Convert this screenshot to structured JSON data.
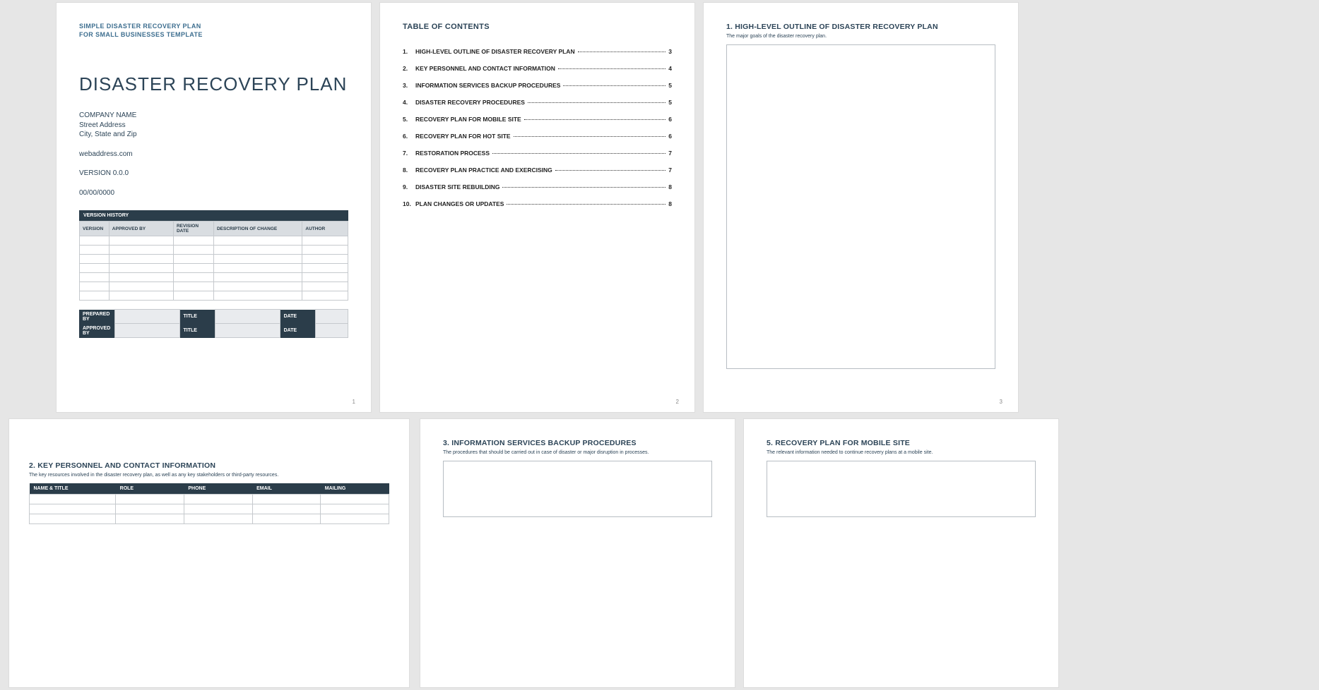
{
  "cover": {
    "small_header_1": "SIMPLE DISASTER RECOVERY PLAN",
    "small_header_2": "FOR SMALL BUSINESSES TEMPLATE",
    "title": "DISASTER RECOVERY PLAN",
    "company": "COMPANY NAME",
    "street": "Street Address",
    "city": "City, State and Zip",
    "web": "webaddress.com",
    "version": "VERSION 0.0.0",
    "date": "00/00/0000",
    "version_history_label": "VERSION HISTORY",
    "vh_cols": {
      "version": "VERSION",
      "approved": "APPROVED BY",
      "revdate": "REVISION DATE",
      "desc": "DESCRIPTION OF CHANGE",
      "author": "AUTHOR"
    },
    "pa": {
      "prepared": "PREPARED BY",
      "approved": "APPROVED BY",
      "title": "TITLE",
      "date": "DATE"
    },
    "pageno": "1"
  },
  "toc": {
    "header": "TABLE OF CONTENTS",
    "items": [
      {
        "n": "1.",
        "t": "HIGH-LEVEL OUTLINE OF DISASTER RECOVERY PLAN",
        "p": "3"
      },
      {
        "n": "2.",
        "t": "KEY PERSONNEL AND CONTACT INFORMATION",
        "p": "4"
      },
      {
        "n": "3.",
        "t": "INFORMATION SERVICES BACKUP PROCEDURES",
        "p": "5"
      },
      {
        "n": "4.",
        "t": "DISASTER RECOVERY PROCEDURES",
        "p": "5"
      },
      {
        "n": "5.",
        "t": "RECOVERY PLAN FOR MOBILE SITE",
        "p": "6"
      },
      {
        "n": "6.",
        "t": "RECOVERY PLAN FOR HOT SITE",
        "p": "6"
      },
      {
        "n": "7.",
        "t": "RESTORATION PROCESS",
        "p": "7"
      },
      {
        "n": "8.",
        "t": "RECOVERY PLAN PRACTICE AND EXERCISING",
        "p": "7"
      },
      {
        "n": "9.",
        "t": "DISASTER SITE REBUILDING",
        "p": "8"
      },
      {
        "n": "10.",
        "t": "PLAN CHANGES OR UPDATES",
        "p": "8"
      }
    ],
    "pageno": "2"
  },
  "s1": {
    "title": "1.  HIGH-LEVEL OUTLINE OF DISASTER RECOVERY PLAN",
    "sub": "The major goals of the disaster recovery plan.",
    "pageno": "3"
  },
  "s2": {
    "title": "2.  KEY PERSONNEL AND CONTACT INFORMATION",
    "sub": "The key resources involved in the disaster recovery plan, as well as any key stakeholders or third-party resources.",
    "cols": {
      "name": "NAME & TITLE",
      "role": "ROLE",
      "phone": "PHONE",
      "email": "EMAIL",
      "mailing": "MAILING"
    }
  },
  "s3": {
    "title": "3.  INFORMATION SERVICES BACKUP PROCEDURES",
    "sub": "The procedures that should be carried out in case of disaster or major disruption in processes."
  },
  "s5": {
    "title": "5.  RECOVERY PLAN FOR MOBILE SITE",
    "sub": "The relevant information needed to continue recovery plans at a mobile site."
  }
}
